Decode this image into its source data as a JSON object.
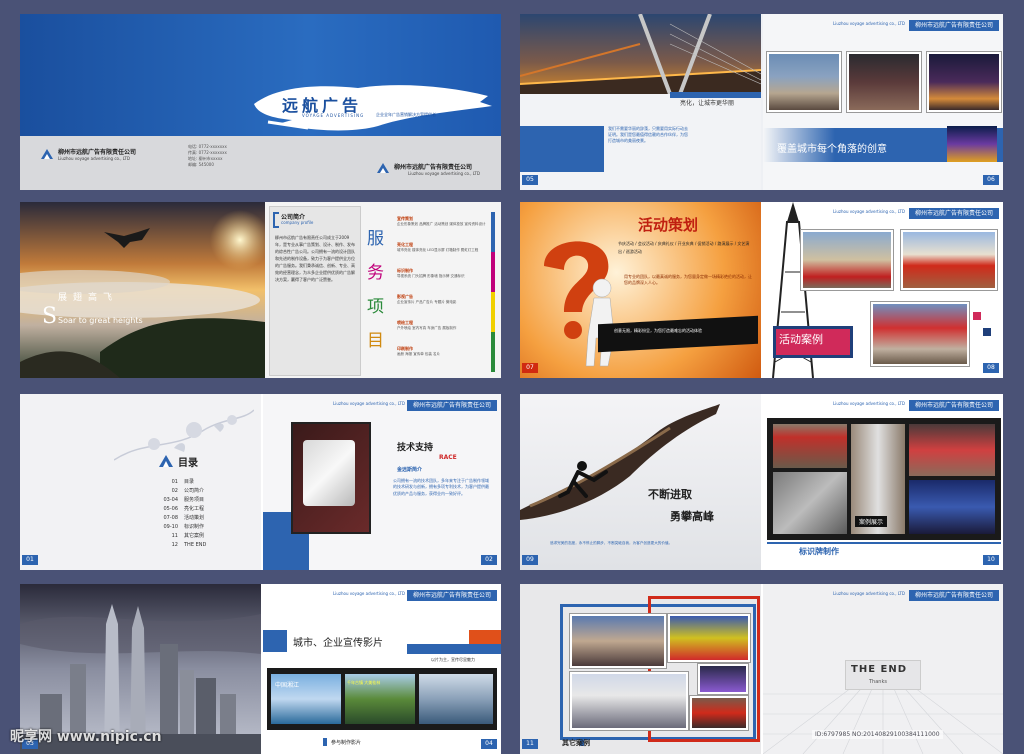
{
  "company": {
    "name_cn": "柳州市远航广告有限责任公司",
    "name_en": "Liuzhou voyage advertising co., LTD",
    "logo_cn": "远航广告",
    "logo_en": "VOYAGE ADVERTISING",
    "tagline": "企业全年广告营销解决方案提供者"
  },
  "cover": {
    "info": [
      "电话: 0772-xxxxxxx",
      "传真: 0772-xxxxxxx",
      "地址: 柳州市xxxxx",
      "邮编: 545000"
    ]
  },
  "pages": {
    "p05": {
      "no": "05",
      "caption": "亮化，让城市更华丽",
      "body": "我们不需要华丽的辞藻，只需要用实际行动去证明。我们是您最值得信赖的合作伙伴，为您打造城市的美丽夜景。"
    },
    "p06": {
      "no": "06",
      "slogan": "覆盖城市每个角落的创意"
    },
    "intro": {
      "cn_big": "展翅高飞",
      "en": "Soar to great heights",
      "letter": "S"
    },
    "company_intro": {
      "title": "公司简介",
      "title_en": "company profile",
      "body": "柳州市远航广告有限责任公司成立于2009年，是专业从事广告策划、设计、制作、发布的综合性广告公司。公司拥有一流的设计团队和先进的制作设备，致力于为客户提供全方位的广告服务。我们秉承诚信、创新、专业、高效的经营理念，为众多企业提供优质的广告解决方案，赢得了客户的广泛赞誉。"
    },
    "services": {
      "big": [
        "服",
        "务",
        "项",
        "目"
      ],
      "items": [
        {
          "name": "宣传策划",
          "desc": "企业形象策划 品牌推广 活动策划 媒体投放 宣传资料设计"
        },
        {
          "name": "亮化工程",
          "desc": "城市亮化 楼体亮化 LED显示屏 灯箱制作 霓虹灯工程"
        },
        {
          "name": "标识制作",
          "desc": "导视系统 门头招牌 形象墙 指示牌 交通标识"
        },
        {
          "name": "影视广告",
          "desc": "企业宣传片 产品广告片 专题片 微电影"
        },
        {
          "name": "喷绘工程",
          "desc": "户外喷绘 室内写真 车身广告 展板制作"
        },
        {
          "name": "印刷制作",
          "desc": "画册 海报 宣传单 包装 名片"
        }
      ]
    },
    "p07": {
      "no": "07",
      "title": "活动策划",
      "list": "节庆活动 / 会议活动 / 庆典礼仪 / 开业庆典 / 促销活动 / 路演展示 / 文艺演出 / 巡游活动",
      "body": "用专业的团队，以最真诚的服务，为您量身定做一场精彩绝伦的活动，让您的品牌深入人心。",
      "quote": "创意无限，精彩纷呈，为您打造最难忘的活动体验"
    },
    "p08": {
      "no": "08",
      "label": "活动案例"
    },
    "toc": {
      "no": "01",
      "title": "目录",
      "items": [
        {
          "n": "01",
          "t": "目录"
        },
        {
          "n": "02",
          "t": "公司简介"
        },
        {
          "n": "03-04",
          "t": "服务项目"
        },
        {
          "n": "05-06",
          "t": "亮化工程"
        },
        {
          "n": "07-08",
          "t": "活动策划"
        },
        {
          "n": "09-10",
          "t": "标识制作"
        },
        {
          "n": "11",
          "t": "其它案例"
        },
        {
          "n": "12",
          "t": "THE END"
        }
      ]
    },
    "p02": {
      "no": "02",
      "title": "技术支持",
      "brand": "RACE",
      "subtitle": "金远斯简介",
      "body": "公司拥有一流的技术团队，多年来专注于广告制作领域的技术研发与创新，拥有多项专利技术，为客户提供最优质的产品与服务，获得业内一致好评。"
    },
    "p09": {
      "no": "09",
      "line1": "不断进取",
      "line2": "勇攀高峰",
      "body": "追求完美的态度，永不停止的脚步，不断突破自我，为客户创造更大的价值。"
    },
    "p10": {
      "no": "10",
      "label": "标识牌制作",
      "case": "案例展示"
    },
    "p03": {
      "no": "03"
    },
    "p04": {
      "no": "04",
      "title": "城市、企业宣传影片",
      "note": "以片为主，宣传尽显魅力",
      "footer": "参与制作影片",
      "film": [
        "中国湘江",
        "千年古镇 大美桂林"
      ]
    },
    "p11": {
      "no": "11",
      "label": "其它案例"
    },
    "p12": {
      "end": "THE END",
      "thanks": "Thanks"
    }
  },
  "watermark": {
    "site": "昵享网 www.nipic.cn",
    "id": "ID:6797985 NO:20140829100384111000"
  }
}
